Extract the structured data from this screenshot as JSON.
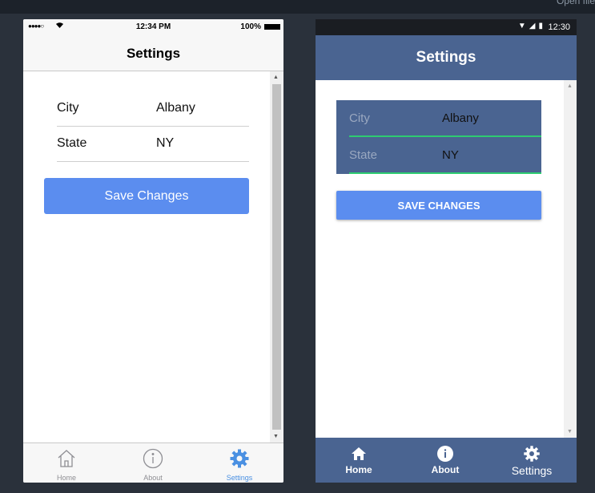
{
  "window": {
    "corner_text": "Open file"
  },
  "ios": {
    "status": {
      "signal": "●●●●○",
      "time": "12:34 PM",
      "battery": "100%"
    },
    "title": "Settings",
    "fields": [
      {
        "label": "City",
        "value": "Albany"
      },
      {
        "label": "State",
        "value": "NY"
      }
    ],
    "save_label": "Save Changes",
    "tabs": [
      {
        "label": "Home",
        "icon": "home-icon"
      },
      {
        "label": "About",
        "icon": "info-icon"
      },
      {
        "label": "Settings",
        "icon": "gear-icon",
        "active": true
      }
    ],
    "colors": {
      "accent": "#5b8def",
      "active_tab": "#4a90e2"
    }
  },
  "android": {
    "status": {
      "time": "12:30"
    },
    "title": "Settings",
    "fields": [
      {
        "label": "City",
        "value": "Albany"
      },
      {
        "label": "State",
        "value": "NY"
      }
    ],
    "save_label": "SAVE CHANGES",
    "tabs": [
      {
        "label": "Home",
        "icon": "home-icon"
      },
      {
        "label": "About",
        "icon": "info-icon"
      },
      {
        "label": "Settings",
        "icon": "gear-icon",
        "active": true
      }
    ],
    "colors": {
      "primary": "#4a6491",
      "accent": "#5b8def",
      "underline": "#2ecc71"
    }
  }
}
